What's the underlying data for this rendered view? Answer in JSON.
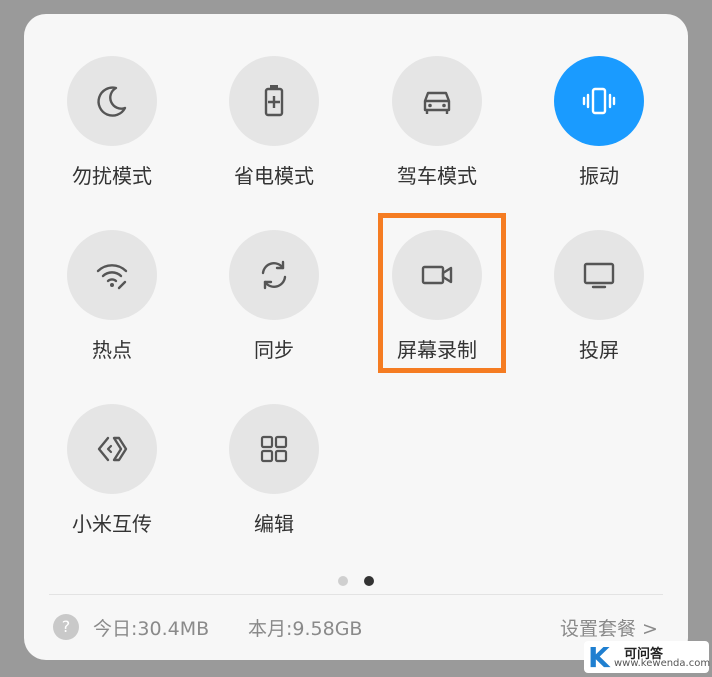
{
  "tiles": [
    {
      "label": "勿扰模式",
      "icon": "moon-icon",
      "active": false
    },
    {
      "label": "省电模式",
      "icon": "battery-saver-icon",
      "active": false
    },
    {
      "label": "驾车模式",
      "icon": "car-icon",
      "active": false
    },
    {
      "label": "振动",
      "icon": "vibrate-icon",
      "active": true
    },
    {
      "label": "热点",
      "icon": "hotspot-icon",
      "active": false
    },
    {
      "label": "同步",
      "icon": "sync-icon",
      "active": false
    },
    {
      "label": "屏幕录制",
      "icon": "screen-record-icon",
      "active": false,
      "highlighted": true
    },
    {
      "label": "投屏",
      "icon": "cast-screen-icon",
      "active": false
    },
    {
      "label": "小米互传",
      "icon": "mi-share-icon",
      "active": false
    },
    {
      "label": "编辑",
      "icon": "grid-edit-icon",
      "active": false
    }
  ],
  "pagination": {
    "pages": 2,
    "current": 2
  },
  "footer": {
    "today": "今日:30.4MB",
    "month": "本月:9.58GB",
    "settings_link": "设置套餐 >",
    "help_icon": "?"
  },
  "watermark": {
    "logo": "K",
    "title": "可问答",
    "url": "www.kewenda.com"
  },
  "colors": {
    "active": "#1a9bff",
    "inactive": "#e5e5e5",
    "highlight": "#f57c22",
    "icon": "#555555"
  }
}
